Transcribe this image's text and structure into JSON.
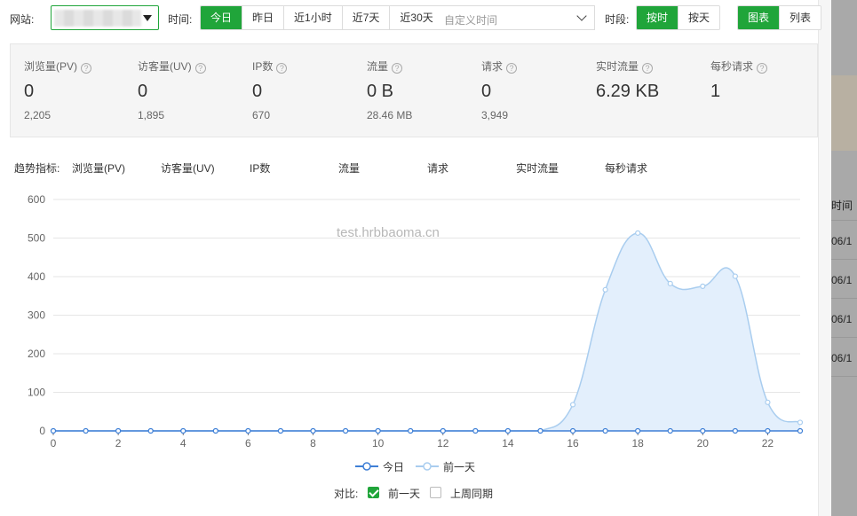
{
  "toolbar": {
    "site_label": "网站:",
    "time_label": "时间:",
    "time_options": [
      "今日",
      "昨日",
      "近1小时",
      "近7天",
      "近30天"
    ],
    "custom_time_placeholder": "自定义时间",
    "period_label": "时段:",
    "period_options": [
      "按时",
      "按天"
    ],
    "view_options": [
      "图表",
      "列表"
    ]
  },
  "stats": [
    {
      "name": "浏览量(PV)",
      "value": "0",
      "sub": "2,205"
    },
    {
      "name": "访客量(UV)",
      "value": "0",
      "sub": "1,895"
    },
    {
      "name": "IP数",
      "value": "0",
      "sub": "670"
    },
    {
      "name": "流量",
      "value": "0 B",
      "sub": "28.46 MB"
    },
    {
      "name": "请求",
      "value": "0",
      "sub": "3,949"
    },
    {
      "name": "实时流量",
      "value": "6.29 KB",
      "sub": ""
    },
    {
      "name": "每秒请求",
      "value": "1",
      "sub": ""
    }
  ],
  "trend": {
    "label": "趋势指标:",
    "metrics": [
      "浏览量(PV)",
      "访客量(UV)",
      "IP数",
      "流量",
      "请求",
      "实时流量",
      "每秒请求"
    ]
  },
  "watermark": "test.hrbbaoma.cn",
  "legend": {
    "today": "今日",
    "yesterday": "前一天"
  },
  "compare": {
    "label": "对比:",
    "opt1": "前一天",
    "opt2": "上周同期"
  },
  "right_panel": {
    "header": "时间",
    "rows": [
      "06/1",
      "06/1",
      "06/1",
      "06/1"
    ]
  },
  "colors": {
    "accent": "#20a53a",
    "today_line": "#3e7fd6",
    "yesterday_line": "#a9cdef",
    "yesterday_fill": "#e3effc"
  },
  "chart_data": {
    "type": "area",
    "x": [
      0,
      1,
      2,
      3,
      4,
      5,
      6,
      7,
      8,
      9,
      10,
      11,
      12,
      13,
      14,
      15,
      16,
      17,
      18,
      19,
      20,
      21,
      22,
      23
    ],
    "series": [
      {
        "name": "今日",
        "values": [
          0,
          0,
          0,
          0,
          0,
          0,
          0,
          0,
          0,
          0,
          0,
          0,
          0,
          0,
          0,
          0,
          0,
          0,
          0,
          0,
          0,
          0,
          0,
          0
        ]
      },
      {
        "name": "前一天",
        "values": [
          0,
          0,
          0,
          0,
          0,
          0,
          0,
          0,
          0,
          0,
          0,
          0,
          0,
          0,
          0,
          0,
          68,
          366,
          513,
          382,
          375,
          401,
          74,
          22
        ]
      }
    ],
    "xticks": [
      0,
      2,
      4,
      6,
      8,
      10,
      12,
      14,
      16,
      18,
      20,
      22
    ],
    "yticks": [
      0,
      100,
      200,
      300,
      400,
      500,
      600
    ],
    "ylim": [
      0,
      600
    ],
    "xlim": [
      0,
      23
    ],
    "grid": true
  }
}
